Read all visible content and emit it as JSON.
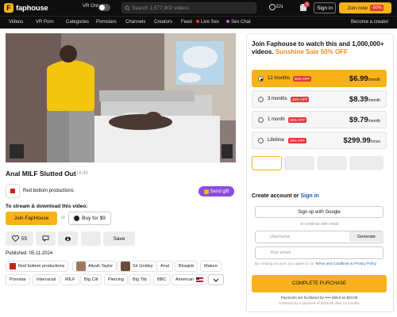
{
  "header": {
    "brand": "faphouse",
    "vr_only_label": "VR Only",
    "search_placeholder": "Search 1,577,902 videos",
    "language": "EN",
    "notification_count": "9",
    "signin_label": "Sign in",
    "join_label": "Join now",
    "join_discount": "-50%"
  },
  "nav": {
    "items": [
      "Videos",
      "VR Porn",
      "Categories",
      "Pornstars",
      "Channels",
      "Creators",
      "Feed",
      "Live Sex",
      "Sex Chat"
    ],
    "become_creator": "Become a creator"
  },
  "video": {
    "title": "Anal MILF Slutted Out",
    "duration": "16:45",
    "producer": "Red bottom productions",
    "send_gift_label": "Send gift",
    "stream_label": "To stream & download this video:",
    "join_label": "Join FapHouse",
    "or_label": "or",
    "buy_label": "Buy for $9",
    "likes": "55",
    "save_label": "Save",
    "published": "Published: 05.11.2024",
    "tags_row1": [
      "Red bottom productions",
      "Aliyah Taylor",
      "Sir Goldey",
      "Anal",
      "Blowjob",
      "Mature"
    ],
    "tags_row2": [
      "Pornstar",
      "Interracial",
      "MILF",
      "Big Clit",
      "Piercing",
      "Big Tits",
      "BBC",
      "American"
    ]
  },
  "signup": {
    "title": "Join Faphouse to watch this and 1,000,000+ videos.",
    "sale": "Sunshine Sale 50% OFF",
    "plans": [
      {
        "label": "12 months",
        "off": "50% OFF",
        "price": "$6.99",
        "unit": "/month",
        "selected": true
      },
      {
        "label": "3 months",
        "off": "40% OFF",
        "price": "$8.39",
        "unit": "/month",
        "selected": false
      },
      {
        "label": "1 month",
        "off": "30% OFF",
        "price": "$9.79",
        "unit": "/month",
        "selected": false
      },
      {
        "label": "Lifetime",
        "off": "25% OFF",
        "price": "$299.99",
        "unit": "/once",
        "selected": false
      }
    ],
    "create_label": "Create account",
    "or_label": "or",
    "signin_label": "Sign in",
    "google_label": "Sign up with Google",
    "or_email": "or continue with email",
    "username_placeholder": "Username",
    "generate_label": "Generate",
    "email_placeholder": "Your email",
    "terms_prefix": "By creating account, you agree to our",
    "terms_link": "Terms and Conditions & Privacy Policy",
    "complete_label": "COMPLETE PURCHASE",
    "fine1": "Payments are facilitated by ••••• Billed as $83.88",
    "fine2": "Followed by a payment of $109.95 after 12 months"
  },
  "colors": {
    "accent": "#f7b21a",
    "topbar": "#0e0e0e",
    "gift": "#8c4be0",
    "sale": "#f08a1c",
    "badge": "#e03a3a"
  }
}
